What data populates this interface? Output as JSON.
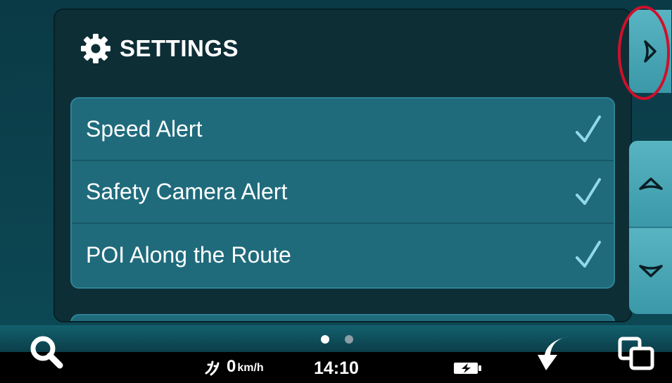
{
  "panel": {
    "title": "SETTINGS",
    "title_icon": "gear-icon"
  },
  "settings_items": [
    {
      "label": "Speed Alert",
      "checked": true,
      "icon": "check-icon"
    },
    {
      "label": "Safety Camera Alert",
      "checked": true,
      "icon": "check-icon"
    },
    {
      "label": "POI Along the Route",
      "checked": true,
      "icon": "check-icon"
    }
  ],
  "side_buttons": {
    "next_page": {
      "icon": "chevron-right-icon"
    },
    "scroll_up": {
      "icon": "chevron-up-icon"
    },
    "scroll_down": {
      "icon": "chevron-down-icon"
    }
  },
  "bottom_bar": {
    "search_icon": "search-icon",
    "page_dots": {
      "count": 2,
      "active_index": 0
    },
    "speed": {
      "value": "0",
      "unit": "km/h",
      "icon": "speed-icon"
    },
    "clock": "14:10",
    "battery_icon": "battery-charging-icon",
    "back_icon": "back-arrow-icon",
    "windows_icon": "windows-icon"
  },
  "colors": {
    "background": "#0a3a45",
    "panel": "#0e2e36",
    "list_bg": "#1f6b7c",
    "accent": "#4aa7b6",
    "checkmark": "#8fd9ea",
    "highlight": "#d0102a"
  }
}
